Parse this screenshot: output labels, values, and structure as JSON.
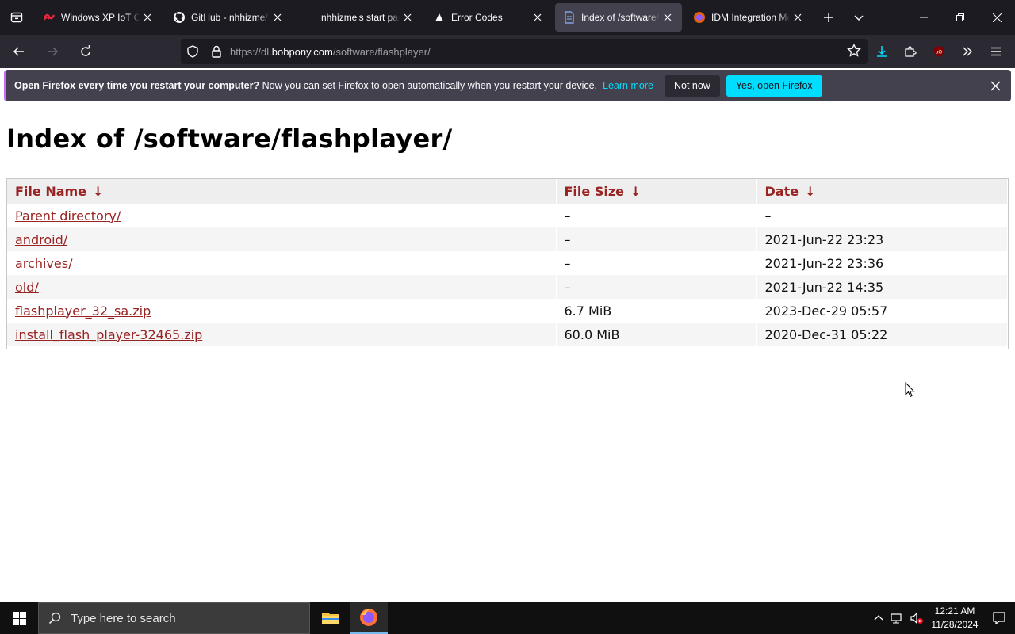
{
  "browser": {
    "tabs": [
      {
        "title": "Windows XP IoT Co",
        "icon": "windows-xp-red-icon",
        "active": false
      },
      {
        "title": "GitHub - nhhizme/",
        "icon": "github-icon",
        "active": false
      },
      {
        "title": "nhhizme's start pag",
        "icon": "",
        "active": false
      },
      {
        "title": "Error Codes",
        "icon": "triangle-icon",
        "active": false
      },
      {
        "title": "Index of /software/",
        "icon": "document-icon",
        "active": true
      },
      {
        "title": "IDM Integration Mo",
        "icon": "firefox-addon-icon",
        "active": false
      }
    ],
    "url": {
      "prefix": "https://dl.",
      "host": "bobpony.com",
      "path": "/software/flashplayer/"
    }
  },
  "notification": {
    "bold": "Open Firefox every time you restart your computer?",
    "text": " Now you can set Firefox to open automatically when you restart your device.",
    "learn_more": "Learn more",
    "not_now": "Not now",
    "yes": "Yes, open Firefox"
  },
  "page": {
    "title": "Index of /software/flashplayer/",
    "columns": {
      "name": "File Name",
      "size": "File Size",
      "date": "Date",
      "sort_arrow": "↓"
    },
    "rows": [
      {
        "name": "Parent directory/",
        "size": "–",
        "date": "–"
      },
      {
        "name": "android/",
        "size": "–",
        "date": "2021-Jun-22 23:23"
      },
      {
        "name": "archives/",
        "size": "–",
        "date": "2021-Jun-22 23:36"
      },
      {
        "name": "old/",
        "size": "–",
        "date": "2021-Jun-22 14:35"
      },
      {
        "name": "flashplayer_32_sa.zip",
        "size": "6.7 MiB",
        "date": "2023-Dec-29 05:57"
      },
      {
        "name": "install_flash_player-32465.zip",
        "size": "60.0 MiB",
        "date": "2020-Dec-31 05:22"
      }
    ]
  },
  "taskbar": {
    "search_placeholder": "Type here to search",
    "time": "12:21 AM",
    "date": "11/28/2024"
  },
  "colors": {
    "link": "#992222",
    "accent": "#00ddff",
    "tab_bg": "#1c1b22",
    "toolbar_bg": "#2b2a33"
  }
}
